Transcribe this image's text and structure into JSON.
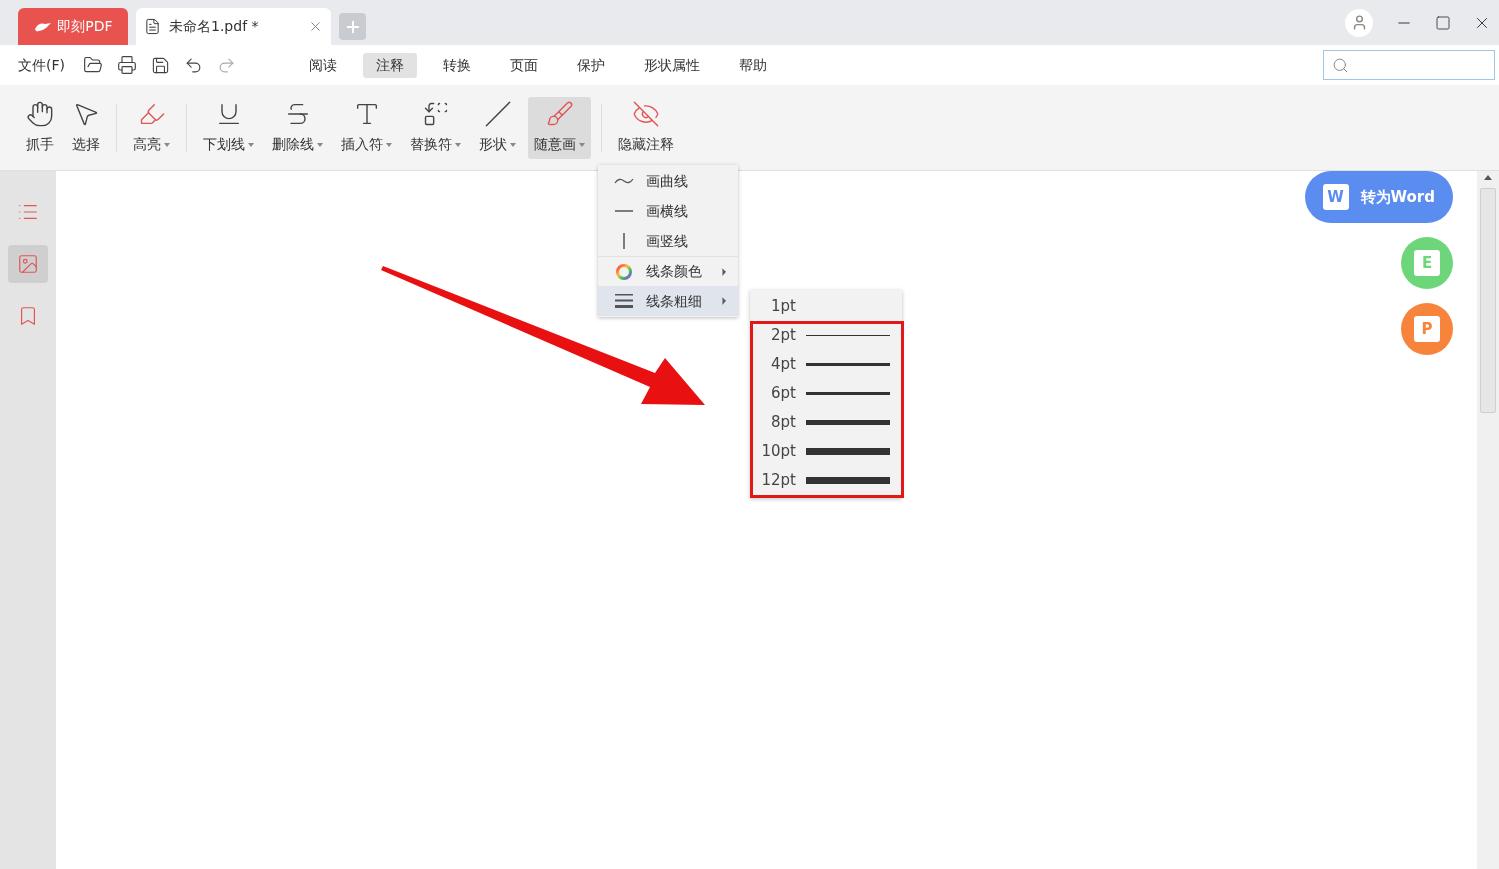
{
  "app_tab": {
    "label": "即刻PDF"
  },
  "document_tab": {
    "title": "未命名1.pdf *",
    "selected": true
  },
  "menu_bar": {
    "file_menu": "文件(F)",
    "tabs": [
      {
        "label": "阅读",
        "selected": false
      },
      {
        "label": "注释",
        "selected": true
      },
      {
        "label": "转换",
        "selected": false
      },
      {
        "label": "页面",
        "selected": false
      },
      {
        "label": "保护",
        "selected": false
      },
      {
        "label": "形状属性",
        "selected": false
      },
      {
        "label": "帮助",
        "selected": false
      }
    ]
  },
  "toolbar": [
    {
      "kind": "hand",
      "label": "抓手",
      "dropdown": false,
      "selected": false
    },
    {
      "kind": "select",
      "label": "选择",
      "dropdown": false,
      "selected": false
    },
    {
      "kind": "highlight",
      "label": "高亮",
      "dropdown": true,
      "selected": false
    },
    {
      "kind": "underline",
      "label": "下划线",
      "dropdown": true,
      "selected": false
    },
    {
      "kind": "strikethrough",
      "label": "删除线",
      "dropdown": true,
      "selected": false
    },
    {
      "kind": "insert",
      "label": "插入符",
      "dropdown": true,
      "selected": false
    },
    {
      "kind": "replace",
      "label": "替换符",
      "dropdown": true,
      "selected": false
    },
    {
      "kind": "shape",
      "label": "形状",
      "dropdown": true,
      "selected": false
    },
    {
      "kind": "freehand",
      "label": "随意画",
      "dropdown": true,
      "selected": true
    },
    {
      "kind": "hide",
      "label": "隐藏注释",
      "dropdown": false,
      "selected": false
    }
  ],
  "sidebar": [
    {
      "kind": "outline",
      "selected": false
    },
    {
      "kind": "thumbnails",
      "selected": true
    },
    {
      "kind": "bookmarks",
      "selected": false
    }
  ],
  "freehand_menu": [
    {
      "kind": "curve",
      "label": "画曲线",
      "submenu": false,
      "selected": false
    },
    {
      "kind": "hline",
      "label": "画横线",
      "submenu": false,
      "selected": false
    },
    {
      "kind": "vline",
      "label": "画竖线",
      "submenu": false,
      "selected": false
    },
    {
      "kind": "color",
      "label": "线条颜色",
      "submenu": true,
      "selected": false
    },
    {
      "kind": "width",
      "label": "线条粗细",
      "submenu": true,
      "selected": true
    }
  ],
  "line_width_menu": [
    {
      "label": "1pt"
    },
    {
      "label": "2pt"
    },
    {
      "label": "4pt"
    },
    {
      "label": "6pt"
    },
    {
      "label": "8pt"
    },
    {
      "label": "10pt"
    },
    {
      "label": "12pt"
    }
  ],
  "convert_buttons": [
    {
      "letter": "W",
      "label": "转为Word",
      "color": "#5b8cf0"
    },
    {
      "letter": "E",
      "color": "#6ed67a"
    },
    {
      "letter": "P",
      "color": "#f7843a"
    }
  ]
}
